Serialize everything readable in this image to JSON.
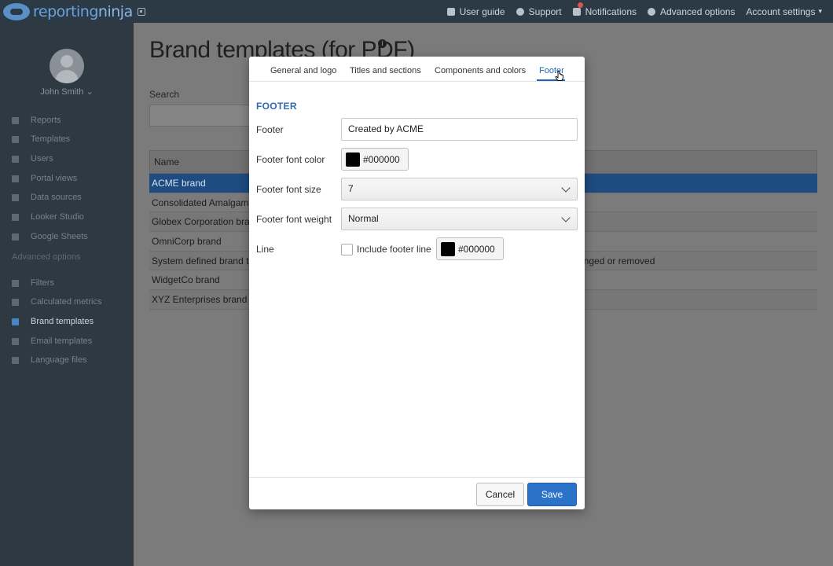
{
  "topbar": {
    "logo": {
      "part1": "reporting",
      "part2": "ninja"
    },
    "nav": [
      {
        "label": "User guide",
        "icon": "book-icon"
      },
      {
        "label": "Support",
        "icon": "lifebuoy-icon"
      },
      {
        "label": "Notifications",
        "icon": "bell-icon"
      },
      {
        "label": "Advanced options",
        "icon": "circle-minus-icon"
      },
      {
        "label": "Account settings",
        "icon": "caret-down-icon"
      }
    ]
  },
  "sidebar": {
    "user": "John Smith",
    "items": [
      {
        "label": "Reports"
      },
      {
        "label": "Templates"
      },
      {
        "label": "Users"
      },
      {
        "label": "Portal views"
      },
      {
        "label": "Data sources"
      },
      {
        "label": "Looker Studio"
      },
      {
        "label": "Google Sheets"
      }
    ],
    "advanced_heading": "Advanced options",
    "advanced_items": [
      {
        "label": "Filters"
      },
      {
        "label": "Calculated metrics"
      },
      {
        "label": "Brand templates",
        "active": true
      },
      {
        "label": "Email templates"
      },
      {
        "label": "Language files"
      }
    ]
  },
  "main": {
    "title": "Brand templates (for PDF)",
    "search_label": "Search",
    "table": {
      "header_name": "Name",
      "rows": [
        {
          "name": "ACME brand",
          "note": ""
        },
        {
          "name": "Consolidated Amalgama",
          "note": ""
        },
        {
          "name": "Globex Corporation brar",
          "note": ""
        },
        {
          "name": "OmniCorp brand",
          "note": ""
        },
        {
          "name": "System defined brand te",
          "note": "anged or removed"
        },
        {
          "name": "WidgetCo brand",
          "note": ""
        },
        {
          "name": "XYZ Enterprises brand",
          "note": ""
        }
      ]
    }
  },
  "modal": {
    "tabs": [
      {
        "label": "General and logo"
      },
      {
        "label": "Titles and sections"
      },
      {
        "label": "Components and colors"
      },
      {
        "label": "Footer",
        "active": true
      }
    ],
    "section_title": "FOOTER",
    "fields": {
      "footer_label": "Footer",
      "footer_value": "Created by ACME",
      "font_color_label": "Footer font color",
      "font_color_value": "#000000",
      "font_size_label": "Footer font size",
      "font_size_value": "7",
      "font_weight_label": "Footer font weight",
      "font_weight_value": "Normal",
      "line_label": "Line",
      "include_line_label": "Include footer line",
      "include_line_checked": false,
      "line_color_value": "#000000"
    },
    "buttons": {
      "cancel": "Cancel",
      "save": "Save"
    }
  },
  "colors": {
    "accent": "#2a73c9",
    "sidebar": "#2e3941",
    "topbar": "#2b3a45"
  }
}
